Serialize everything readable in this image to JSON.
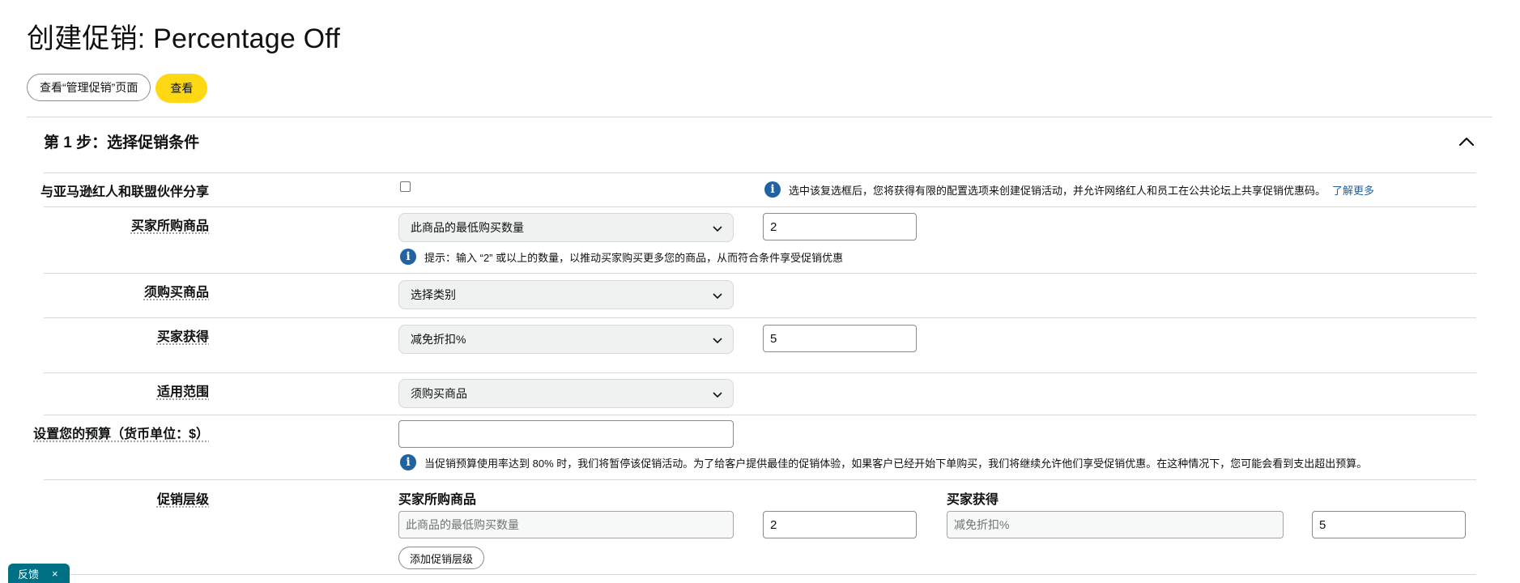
{
  "page": {
    "title": "创建促销: Percentage Off",
    "view_manage_label": "查看“管理促销”页面",
    "view_label": "查看"
  },
  "step1": {
    "title": "第 1 步：选择促销条件",
    "share": {
      "label": "与亚马逊红人和联盟伙伴分享",
      "checked": false,
      "info": "选中该复选框后，您将获得有限的配置选项来创建促销活动，并允许网络红人和员工在公共论坛上共享促销优惠码。",
      "learn_more": "了解更多"
    },
    "buyer_purchases": {
      "label": "买家所购商品",
      "select_value": "此商品的最低购买数量",
      "input_value": "2",
      "hint": "提示：输入 “2” 或以上的数量，以推动买家购买更多您的商品，从而符合条件享受促销优惠"
    },
    "purchased_items": {
      "label": "须购买商品",
      "select_value": "选择类别"
    },
    "buyer_gets": {
      "label": "买家获得",
      "select_value": "减免折扣%",
      "input_value": "5"
    },
    "applies_to": {
      "label": "适用范围",
      "select_value": "须购买商品"
    },
    "budget": {
      "label": "设置您的预算（货币单位：$）",
      "input_value": "",
      "info": "当促销预算使用率达到 80% 时，我们将暂停该促销活动。为了给客户提供最佳的促销体验，如果客户已经开始下单购买，我们将继续允许他们享受促销优惠。在这种情况下，您可能会看到支出超出预算。"
    },
    "tiers": {
      "label": "促销层级",
      "buyer_purchases_heading": "买家所购商品",
      "buyer_gets_heading": "买家获得",
      "purchase_condition": "此商品的最低购买数量",
      "purchase_value": "2",
      "benefit_condition": "减免折扣%",
      "benefit_value": "5",
      "add_tier_label": "添加促销层级"
    }
  },
  "feedback": {
    "label": "反馈",
    "close": "×"
  },
  "colors": {
    "accent_yellow": "#ffd814",
    "link_blue": "#2162a1",
    "feedback_teal": "#007185"
  }
}
